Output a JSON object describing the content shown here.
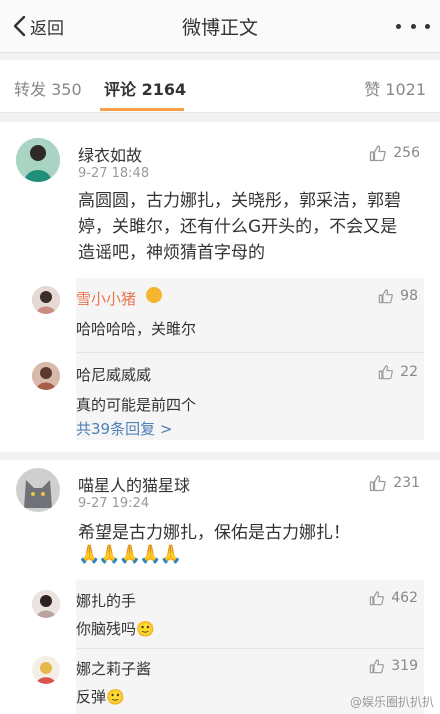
{
  "nav": {
    "back_label": "返回",
    "title": "微博正文"
  },
  "tabs": {
    "repost": "转发 350",
    "comment": "评论 2164",
    "likes": "赞 1021"
  },
  "comments": [
    {
      "name": "绿衣如故",
      "time": "9-27 18:48",
      "likes": "256",
      "text": "高圆圆，古力娜扎，关晓彤，郭采洁，郭碧婷，关雎尔，还有什么G开头的，不会又是造谣吧，神烦猜首字母的",
      "replies": [
        {
          "name": "雪小小猪",
          "text": "哈哈哈哈，关雎尔",
          "likes": "98"
        },
        {
          "name": "哈尼威威威",
          "text": "真的可能是前四个",
          "likes": "22"
        }
      ],
      "more_replies": "共39条回复 >"
    },
    {
      "name": "喵星人的猫星球",
      "time": "9-27 19:24",
      "likes": "231",
      "text": "希望是古力娜扎，保佑是古力娜扎！",
      "emoji": "🙏🙏🙏🙏🙏",
      "replies": [
        {
          "name": "娜扎的手",
          "text": "你脑残吗🙂",
          "likes": "462"
        },
        {
          "name": "娜之莉子酱",
          "text": "反弹🙂",
          "likes": "319"
        }
      ]
    }
  ],
  "watermark": "@娱乐圈扒扒扒",
  "colors": {
    "accent": "#f7a04a",
    "link": "#4d7fb6",
    "vip_name": "#eb7350"
  }
}
